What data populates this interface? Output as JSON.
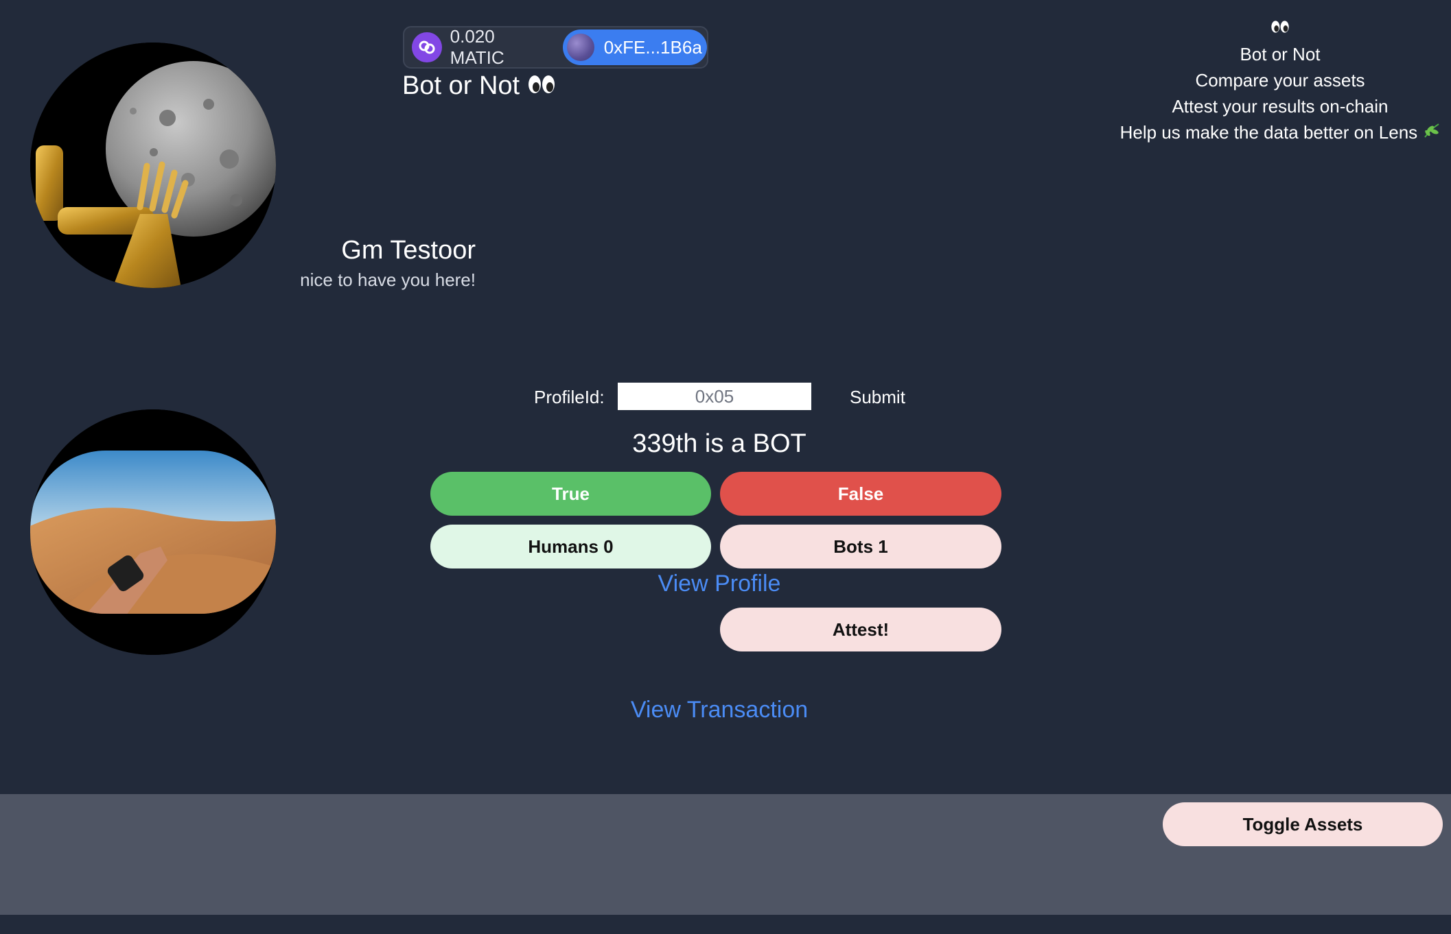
{
  "wallet": {
    "balance": "0.020 MATIC",
    "address": "0xFE...1B6a"
  },
  "app": {
    "title": "Bot or Not"
  },
  "info": {
    "items": [
      "Bot or Not",
      "Compare your assets",
      "Attest your results on-chain",
      "Help us make the data better on Lens"
    ]
  },
  "greeting": {
    "title": "Gm Testoor",
    "subtitle": "nice to have you here!"
  },
  "form": {
    "label": "ProfileId:",
    "input_value": "0x05",
    "submit_label": "Submit"
  },
  "result": {
    "text": "339th is a BOT"
  },
  "vote": {
    "true_label": "True",
    "false_label": "False",
    "humans_label": "Humans 0",
    "bots_label": "Bots 1"
  },
  "links": {
    "view_profile": "View Profile",
    "view_transaction": "View Transaction"
  },
  "actions": {
    "attest_label": "Attest!",
    "toggle_assets_label": "Toggle Assets"
  },
  "colors": {
    "background": "#222a3a",
    "true_green": "#5ac068",
    "false_red": "#e0514b",
    "link_blue": "#4b8cf5",
    "polygon_purple": "#8247e5"
  }
}
